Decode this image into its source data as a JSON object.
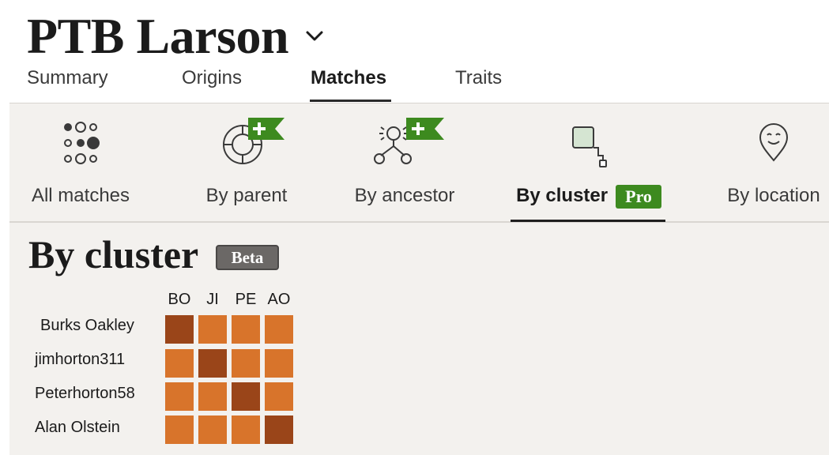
{
  "header": {
    "title": "PTB Larson",
    "tabs": [
      {
        "label": "Summary",
        "active": false
      },
      {
        "label": "Origins",
        "active": false
      },
      {
        "label": "Matches",
        "active": true
      },
      {
        "label": "Traits",
        "active": false
      }
    ]
  },
  "views": [
    {
      "label": "All matches",
      "icon": "dots-grid-icon",
      "active": false
    },
    {
      "label": "By parent",
      "icon": "parent-ring-icon",
      "badge_icon": "plus-flag-icon",
      "active": false
    },
    {
      "label": "By ancestor",
      "icon": "ancestor-tree-icon",
      "badge_icon": "plus-flag-icon",
      "active": false
    },
    {
      "label": "By cluster",
      "icon": "cluster-squares-icon",
      "badge": "Pro",
      "active": true
    },
    {
      "label": "By location",
      "icon": "location-face-icon",
      "active": false
    }
  ],
  "section": {
    "title": "By cluster",
    "badge": "Beta"
  },
  "cluster": {
    "columns": [
      "BO",
      "JI",
      "PE",
      "AO"
    ],
    "rows": [
      {
        "name": "Burks Oakley",
        "levels": [
          "strong",
          "weak",
          "weak",
          "weak"
        ]
      },
      {
        "name": "jimhorton311",
        "levels": [
          "weak",
          "strong",
          "weak",
          "weak"
        ]
      },
      {
        "name": "Peterhorton58",
        "levels": [
          "weak",
          "weak",
          "strong",
          "weak"
        ]
      },
      {
        "name": "Alan Olstein",
        "levels": [
          "weak",
          "weak",
          "weak",
          "strong"
        ]
      }
    ],
    "colors": {
      "strong": "#9a4519",
      "weak": "#d8742b"
    }
  },
  "colors": {
    "accent_green": "#3d8a1f",
    "background": "#f3f1ee",
    "beta_gray": "#6b6866"
  }
}
